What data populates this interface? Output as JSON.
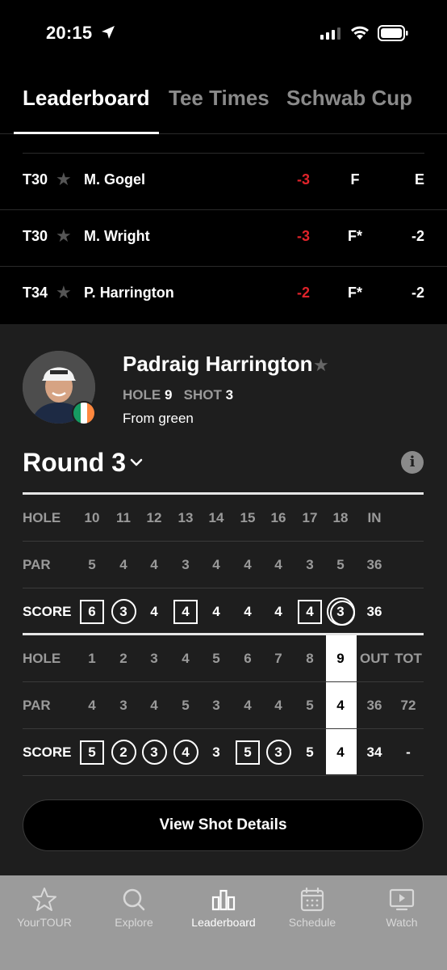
{
  "status": {
    "time": "20:15"
  },
  "tabs": [
    {
      "label": "Leaderboard",
      "active": true
    },
    {
      "label": "Tee Times",
      "active": false
    },
    {
      "label": "Schwab Cup",
      "active": false
    }
  ],
  "leaderboard": [
    {
      "pos": "T30",
      "name": "M. Gogel",
      "score": "-3",
      "thru": "F",
      "today": "E"
    },
    {
      "pos": "T30",
      "name": "M. Wright",
      "score": "-3",
      "thru": "F*",
      "today": "-2"
    },
    {
      "pos": "T34",
      "name": "P. Harrington",
      "score": "-2",
      "thru": "F*",
      "today": "-2"
    }
  ],
  "player": {
    "name": "Padraig Harrington",
    "hole_label": "HOLE",
    "hole": "9",
    "shot_label": "SHOT",
    "shot": "3",
    "from": "From green",
    "flag_colors": [
      "#169b62",
      "#ffffff",
      "#ff883e"
    ]
  },
  "round": {
    "title": "Round 3"
  },
  "scorecard": {
    "back": {
      "hole_label": "HOLE",
      "holes": [
        "10",
        "11",
        "12",
        "13",
        "14",
        "15",
        "16",
        "17",
        "18"
      ],
      "total_label": "IN",
      "par_label": "PAR",
      "pars": [
        "5",
        "4",
        "4",
        "3",
        "4",
        "4",
        "4",
        "3",
        "5"
      ],
      "par_total": "36",
      "score_label": "SCORE",
      "scores": [
        "6",
        "3",
        "4",
        "4",
        "4",
        "4",
        "4",
        "4",
        "3"
      ],
      "score_marks": [
        "box",
        "circle",
        "none",
        "box",
        "none",
        "none",
        "none",
        "box",
        "dcircle"
      ],
      "score_total": "36"
    },
    "front": {
      "hole_label": "HOLE",
      "holes": [
        "1",
        "2",
        "3",
        "4",
        "5",
        "6",
        "7",
        "8",
        "9"
      ],
      "out_label": "OUT",
      "tot_label": "TOT",
      "par_label": "PAR",
      "pars": [
        "4",
        "3",
        "4",
        "5",
        "3",
        "4",
        "4",
        "5",
        "4"
      ],
      "par_out": "36",
      "par_tot": "72",
      "score_label": "SCORE",
      "scores": [
        "5",
        "2",
        "3",
        "4",
        "3",
        "5",
        "3",
        "5",
        "4"
      ],
      "score_marks": [
        "box",
        "circle",
        "circle",
        "circle",
        "none",
        "box",
        "circle",
        "none",
        "none"
      ],
      "score_out": "34",
      "score_tot": "-",
      "current_hole_index": 8
    }
  },
  "actions": {
    "view_shot_details": "View Shot Details"
  },
  "bottom_nav": [
    {
      "label": "YourTOUR",
      "icon": "star-icon",
      "active": false
    },
    {
      "label": "Explore",
      "icon": "search-icon",
      "active": false
    },
    {
      "label": "Leaderboard",
      "icon": "bar-chart-icon",
      "active": true
    },
    {
      "label": "Schedule",
      "icon": "calendar-icon",
      "active": false
    },
    {
      "label": "Watch",
      "icon": "play-icon",
      "active": false
    }
  ]
}
